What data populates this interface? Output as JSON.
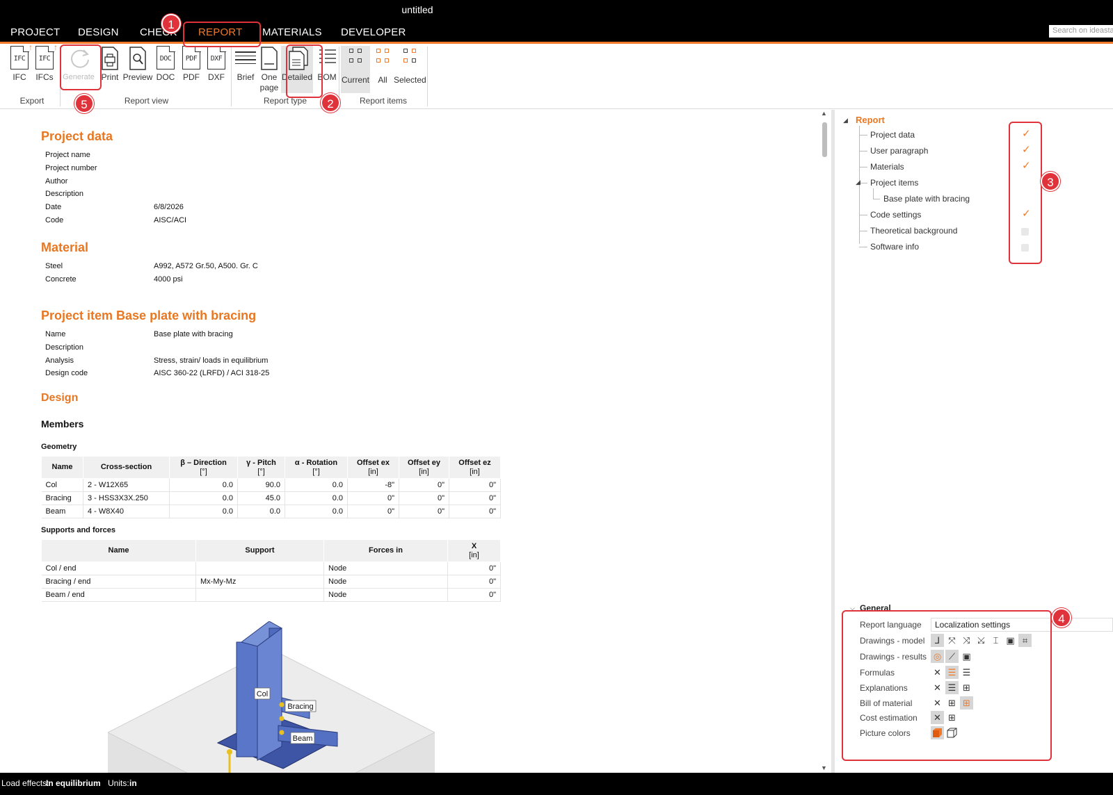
{
  "window": {
    "title": "untitled"
  },
  "menu": {
    "items": [
      "PROJECT",
      "DESIGN",
      "CHECK",
      "REPORT",
      "MATERIALS",
      "DEVELOPER"
    ],
    "active": "REPORT"
  },
  "search": {
    "placeholder": "Search on ideastatica"
  },
  "ribbon": {
    "export": {
      "label": "Export",
      "ifc": "IFC",
      "ifcs": "IFCs"
    },
    "report_view": {
      "label": "Report view",
      "generate": "Generate",
      "print": "Print",
      "preview": "Preview",
      "doc": "DOC",
      "pdf": "PDF",
      "dxf": "DXF"
    },
    "report_type": {
      "label": "Report type",
      "brief": "Brief",
      "one_page": "One page",
      "detailed": "Detailed",
      "bom": "BOM"
    },
    "report_items": {
      "label": "Report items",
      "current": "Current",
      "all": "All",
      "selected": "Selected"
    },
    "icon_texts": {
      "ifc": "IFC",
      "doc": "DOC",
      "pdf": "PDF",
      "dxf": "DXF"
    }
  },
  "annotations": [
    "1",
    "2",
    "3",
    "4",
    "5"
  ],
  "report": {
    "project_data": {
      "heading": "Project data",
      "rows": [
        {
          "k": "Project name",
          "v": ""
        },
        {
          "k": "Project number",
          "v": ""
        },
        {
          "k": "Author",
          "v": ""
        },
        {
          "k": "Description",
          "v": ""
        },
        {
          "k": "Date",
          "v": "6/8/2026"
        },
        {
          "k": "Code",
          "v": "AISC/ACI"
        }
      ]
    },
    "material": {
      "heading": "Material",
      "rows": [
        {
          "k": "Steel",
          "v": "A992, A572 Gr.50, A500. Gr. C"
        },
        {
          "k": "Concrete",
          "v": "4000 psi"
        }
      ]
    },
    "project_item": {
      "heading": "Project item Base plate with bracing",
      "rows": [
        {
          "k": "Name",
          "v": "Base plate with bracing"
        },
        {
          "k": "Description",
          "v": ""
        },
        {
          "k": "Analysis",
          "v": "Stress, strain/ loads in equilibrium"
        },
        {
          "k": "Design code",
          "v": "AISC 360-22 (LRFD) / ACI 318-25"
        }
      ]
    },
    "design": {
      "heading": "Design",
      "members": "Members",
      "geometry": "Geometry",
      "supports": "Supports and forces"
    },
    "geometry_table": {
      "headers": [
        {
          "t": "Name",
          "u": ""
        },
        {
          "t": "Cross-section",
          "u": ""
        },
        {
          "t": "β – Direction",
          "u": "[°]"
        },
        {
          "t": "γ - Pitch",
          "u": "[°]"
        },
        {
          "t": "α - Rotation",
          "u": "[°]"
        },
        {
          "t": "Offset ex",
          "u": "[in]"
        },
        {
          "t": "Offset ey",
          "u": "[in]"
        },
        {
          "t": "Offset ez",
          "u": "[in]"
        }
      ],
      "rows": [
        [
          "Col",
          "2 - W12X65",
          "0.0",
          "90.0",
          "0.0",
          "-8\"",
          "0\"",
          "0\""
        ],
        [
          "Bracing",
          "3 - HSS3X3X.250",
          "0.0",
          "45.0",
          "0.0",
          "0\"",
          "0\"",
          "0\""
        ],
        [
          "Beam",
          "4 - W8X40",
          "0.0",
          "0.0",
          "0.0",
          "0\"",
          "0\"",
          "0\""
        ]
      ]
    },
    "supports_table": {
      "headers": [
        {
          "t": "Name",
          "u": ""
        },
        {
          "t": "Support",
          "u": ""
        },
        {
          "t": "Forces in",
          "u": ""
        },
        {
          "t": "X",
          "u": "[in]"
        }
      ],
      "rows": [
        [
          "Col / end",
          "",
          "Node",
          "0\""
        ],
        [
          "Bracing / end",
          "Mx-My-Mz",
          "Node",
          "0\""
        ],
        [
          "Beam / end",
          "",
          "Node",
          "0\""
        ]
      ]
    },
    "picture_labels": {
      "col": "Col",
      "bracing": "Bracing",
      "beam": "Beam"
    }
  },
  "tree": {
    "root": "Report",
    "items": [
      {
        "label": "Project data",
        "checked": true
      },
      {
        "label": "User paragraph",
        "checked": true
      },
      {
        "label": "Materials",
        "checked": true
      },
      {
        "label": "Project items",
        "checked": null
      },
      {
        "label": "Base plate with bracing",
        "checked": null
      },
      {
        "label": "Code settings",
        "checked": true
      },
      {
        "label": "Theoretical background",
        "checked": false
      },
      {
        "label": "Software info",
        "checked": false
      }
    ]
  },
  "general": {
    "title": "General",
    "report_language": "Report language",
    "localization": "Localization settings",
    "drawings_model": "Drawings - model",
    "drawings_results": "Drawings - results",
    "formulas": "Formulas",
    "explanations": "Explanations",
    "bill_of_material": "Bill of material",
    "cost_estimation": "Cost estimation",
    "picture_colors": "Picture colors"
  },
  "status": {
    "load_effects_label": "Load effects:",
    "load_effects_value": "In equilibrium",
    "units_label": "Units:",
    "units_value": "in"
  },
  "colors": {
    "accent": "#f07a2a",
    "heading": "#e87722",
    "annotation": "#e0323a"
  }
}
